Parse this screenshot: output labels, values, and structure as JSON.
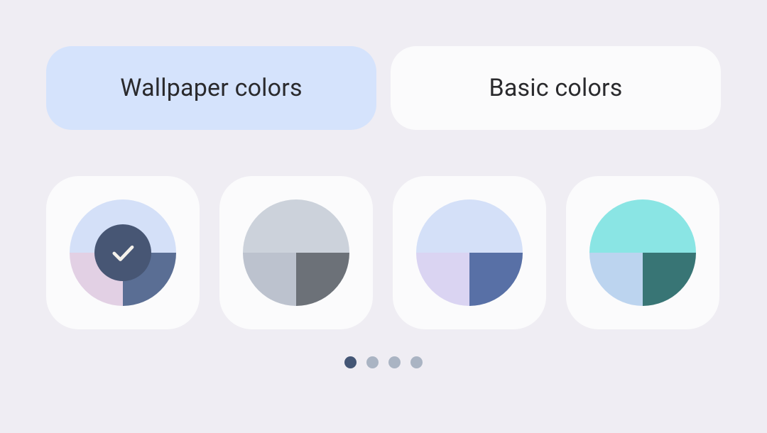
{
  "tabs": [
    {
      "label": "Wallpaper colors",
      "active": true
    },
    {
      "label": "Basic colors",
      "active": false
    }
  ],
  "swatches": [
    {
      "top": "#d4e0f8",
      "bl": "#e2d0e4",
      "br": "#5a6e94",
      "selected": true,
      "badge_bg": "#475674",
      "check_color": "#f5f2ec"
    },
    {
      "top": "#ccd2db",
      "bl": "#bcc2ce",
      "br": "#6c7178",
      "selected": false
    },
    {
      "top": "#d4e0f8",
      "bl": "#dad4f2",
      "br": "#5870a6",
      "selected": false
    },
    {
      "top": "#8ae5e4",
      "bl": "#bcd4ef",
      "br": "#387575",
      "selected": false
    }
  ],
  "pagination": {
    "count": 4,
    "active_index": 0,
    "active_color": "#445675",
    "inactive_color": "#aab4c3"
  }
}
